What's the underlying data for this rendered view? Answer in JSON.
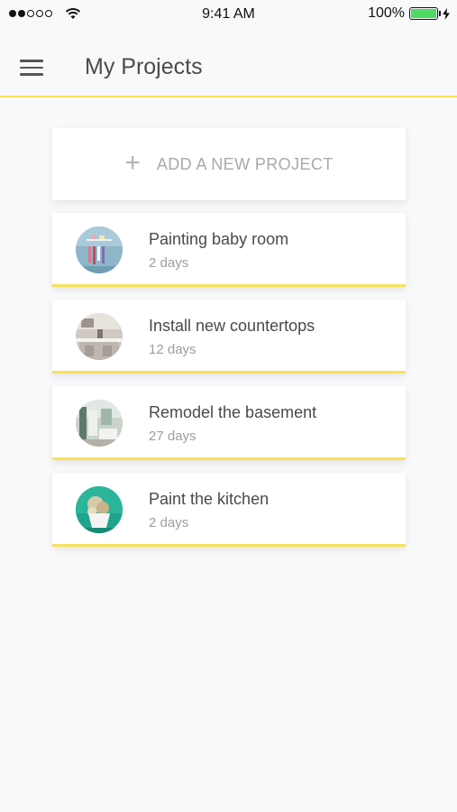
{
  "status_bar": {
    "time": "9:41 AM",
    "battery_percent": "100%",
    "signal_bars_filled": 2,
    "signal_bars_total": 5,
    "battery_level": 1.0,
    "battery_color": "#4cd964"
  },
  "header": {
    "title": "My Projects",
    "menu_icon": "hamburger-menu-icon",
    "accent_color": "#f7e25a"
  },
  "add_project": {
    "icon": "plus-icon",
    "label": "ADD A NEW PROJECT"
  },
  "projects": [
    {
      "title": "Painting baby room",
      "subtitle": "2 days",
      "thumbnail": "baby-room-photo"
    },
    {
      "title": "Install new countertops",
      "subtitle": "12 days",
      "thumbnail": "countertops-photo"
    },
    {
      "title": "Remodel the basement",
      "subtitle": "27 days",
      "thumbnail": "basement-photo"
    },
    {
      "title": "Paint the kitchen",
      "subtitle": "2 days",
      "thumbnail": "kitchen-photo"
    }
  ]
}
